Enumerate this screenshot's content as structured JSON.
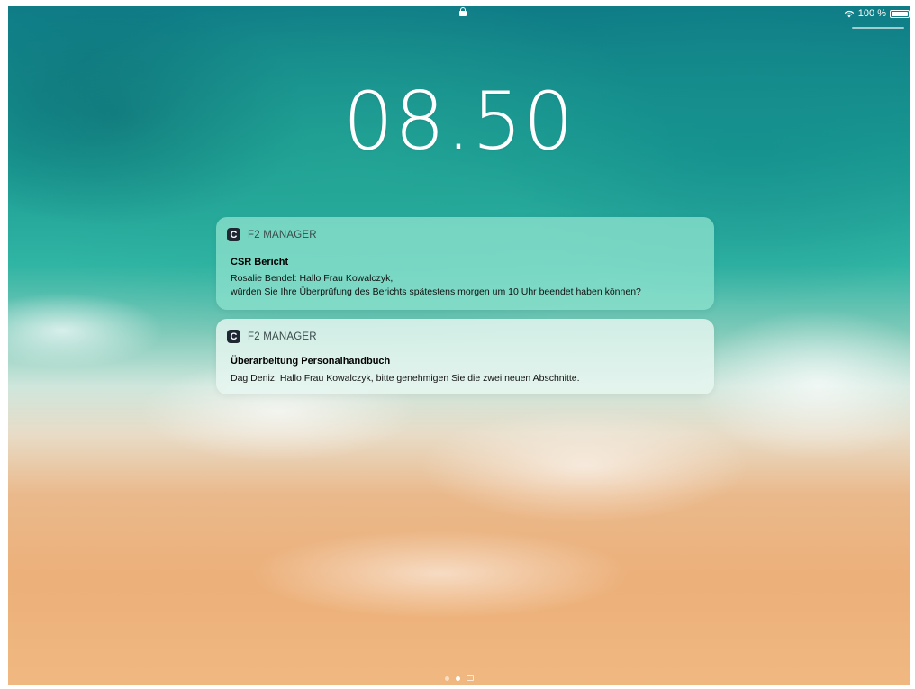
{
  "status_bar": {
    "wifi_icon": "wifi-icon",
    "battery_percent": "100 %",
    "battery_icon": "battery-icon",
    "lock_icon": "lock-icon"
  },
  "lock_screen": {
    "time": "08.50"
  },
  "notifications": [
    {
      "app_name": "F2 MANAGER",
      "app_icon_letter": "C",
      "title": "CSR Bericht",
      "body_line1": "Rosalie Bendel: Hallo Frau Kowalczyk,",
      "body_line2": "würden Sie Ihre Überprüfung des Berichts spätestens morgen um 10 Uhr beendet haben können?"
    },
    {
      "app_name": "F2 MANAGER",
      "app_icon_letter": "C",
      "title": "Überarbeitung Personalhandbuch",
      "body_line1": "Dag Deniz: Hallo Frau Kowalczyk, bitte genehmigen Sie die zwei neuen Abschnitte."
    }
  ],
  "page_indicator": {
    "pages": 3,
    "active_index": 1
  }
}
